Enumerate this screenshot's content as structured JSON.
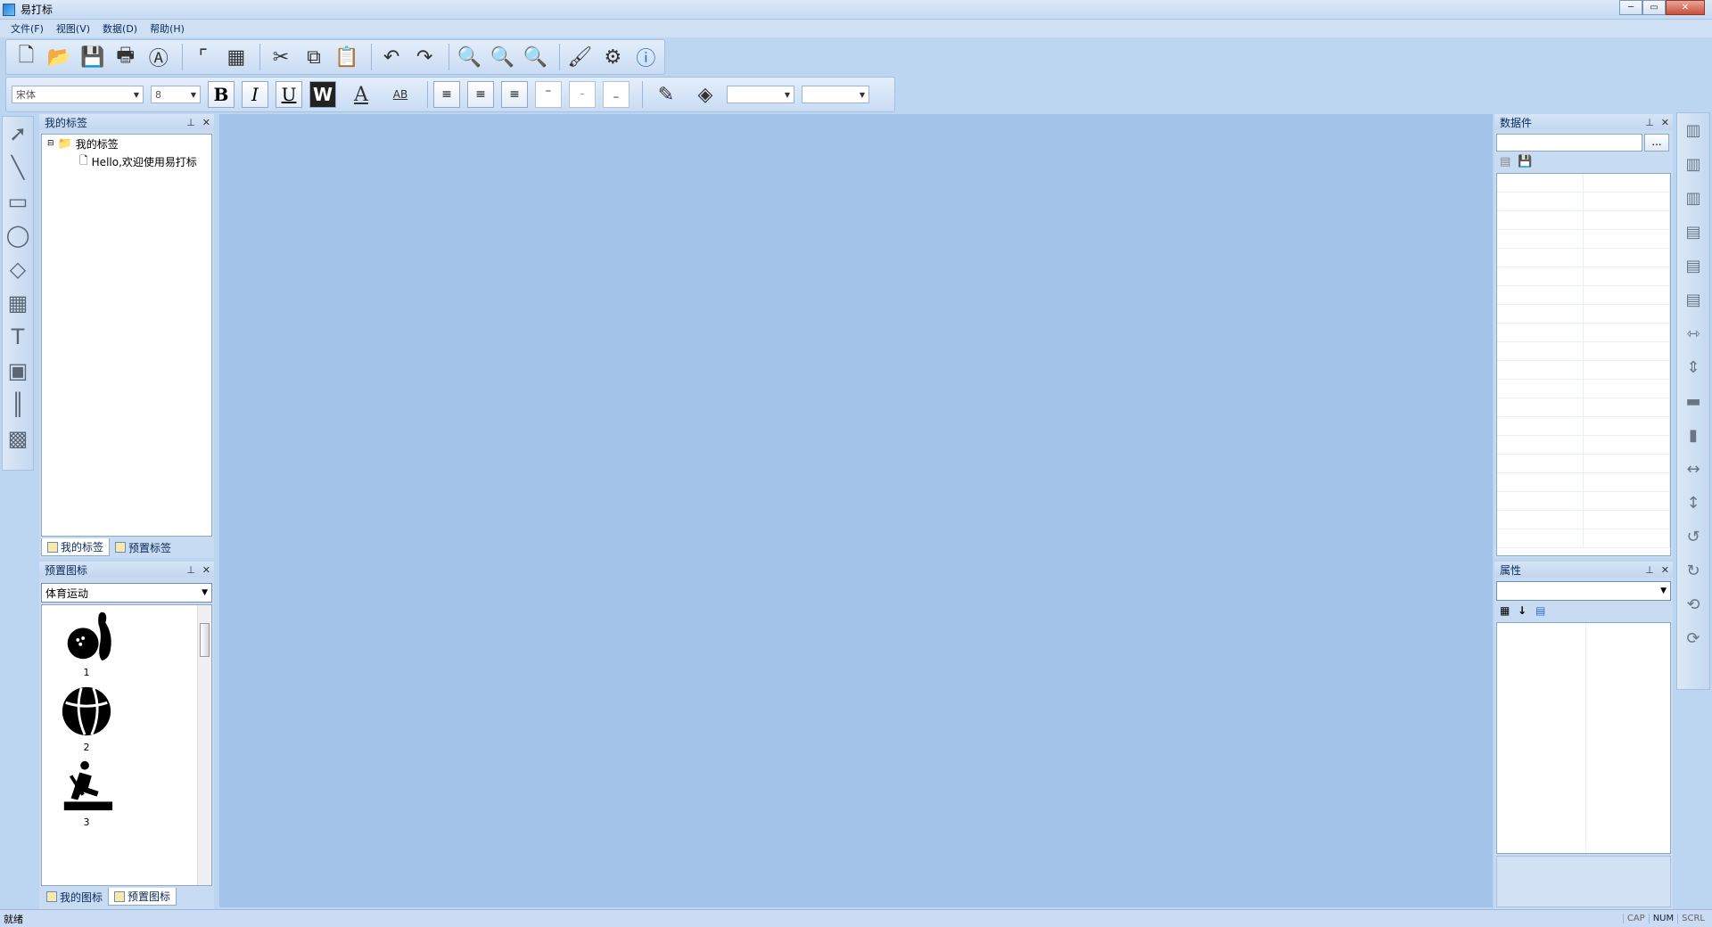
{
  "window": {
    "title": "易打标",
    "minimize": "─",
    "maximize": "▭",
    "close": "✕"
  },
  "menu": [
    {
      "label": "文件(F)"
    },
    {
      "label": "视图(V)"
    },
    {
      "label": "数据(D)"
    },
    {
      "label": "帮助(H)"
    }
  ],
  "format": {
    "font": "宋体",
    "size": "8",
    "bold": "B",
    "italic": "I",
    "underline": "U",
    "word": "W",
    "font_color": "A",
    "spacing": "AB"
  },
  "labels_panel": {
    "title": "我的标签",
    "root": "我的标签",
    "child": "Hello,欢迎使用易打标",
    "tabs": [
      "我的标签",
      "预置标签"
    ]
  },
  "preset_icons_panel": {
    "title": "预置图标",
    "category": "体育运动",
    "items": [
      {
        "caption": "1",
        "icon": "bowling-icon"
      },
      {
        "caption": "2",
        "icon": "basketball-icon"
      },
      {
        "caption": "3",
        "icon": "rowing-machine-icon"
      }
    ],
    "tabs": [
      "我的图标",
      "预置图标"
    ]
  },
  "datasource_panel": {
    "title": "数据件",
    "browse": "..."
  },
  "properties_panel": {
    "title": "属性"
  },
  "status": {
    "text": "就绪",
    "indicators": [
      "CAP",
      "NUM",
      "SCRL"
    ]
  },
  "colors": {
    "canvas": "#a4c3e9",
    "chrome": "#c7dbf3"
  }
}
